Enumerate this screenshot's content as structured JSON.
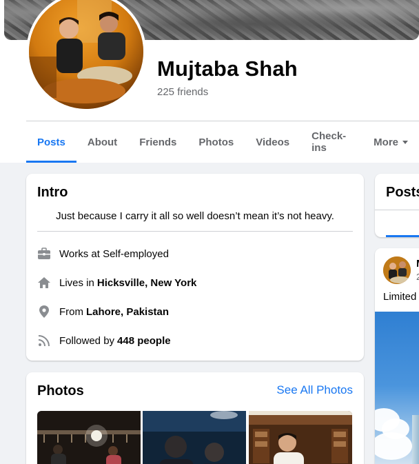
{
  "profile": {
    "name": "Mujtaba Shah",
    "friends_count": "225 friends"
  },
  "tabs": [
    {
      "label": "Posts",
      "active": true
    },
    {
      "label": "About"
    },
    {
      "label": "Friends"
    },
    {
      "label": "Photos"
    },
    {
      "label": "Videos"
    },
    {
      "label": "Check-ins"
    },
    {
      "label": "More"
    }
  ],
  "intro": {
    "title": "Intro",
    "bio": "Just because I carry it all so well doesn’t mean it’s not heavy.",
    "items": [
      {
        "icon": "briefcase-icon",
        "prefix": "Works at Self-employed",
        "bold": ""
      },
      {
        "icon": "home-icon",
        "prefix": "Lives in",
        "bold": "Hicksville, New York"
      },
      {
        "icon": "location-pin-icon",
        "prefix": "From",
        "bold": "Lahore, Pakistan"
      },
      {
        "icon": "rss-feed-icon",
        "prefix": "Followed by",
        "bold": "448 people"
      }
    ]
  },
  "photos": {
    "title": "Photos",
    "see_all": "See All Photos"
  },
  "posts": {
    "title": "Posts",
    "post_author_initial": "M",
    "post_date_partial": "2",
    "post_text": "Limited"
  },
  "colors": {
    "accent": "#1877f2",
    "secondary_text": "#65676b",
    "background": "#f0f2f5"
  }
}
